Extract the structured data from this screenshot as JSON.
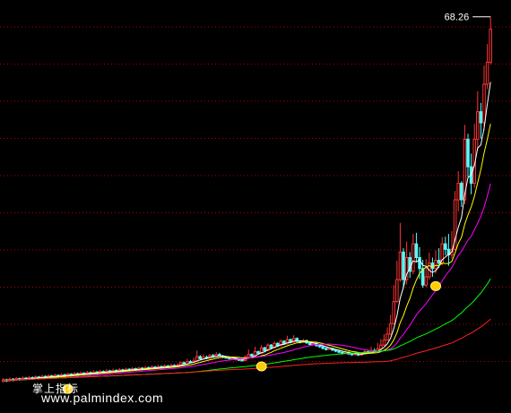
{
  "chart_data": {
    "type": "candlestick",
    "high_label": "68.26",
    "watermark": {
      "line1": "掌上指标",
      "line2": "www.palmindex.com"
    },
    "y_range": [
      0,
      70
    ],
    "grid": true,
    "colors": {
      "up": "#ff3333",
      "down": "#54ffff",
      "ma_fast": "#ffffff",
      "ma_mid": "#ffff00",
      "ma_slow": "#ff00ff",
      "ma_long": "#00ff00",
      "ma_longest": "#ff2020",
      "signal": "#ffcc00",
      "grid": "#b00000"
    },
    "signals": [
      20,
      80,
      134
    ],
    "candles": [
      [
        2.0,
        2.3,
        2.6,
        1.8
      ],
      [
        2.3,
        2.1,
        2.5,
        1.9
      ],
      [
        2.1,
        2.4,
        2.7,
        2.0
      ],
      [
        2.4,
        2.2,
        2.6,
        2.0
      ],
      [
        2.2,
        2.5,
        2.8,
        2.1
      ],
      [
        2.5,
        2.3,
        2.7,
        2.1
      ],
      [
        2.3,
        2.6,
        2.9,
        2.2
      ],
      [
        2.6,
        2.4,
        2.8,
        2.2
      ],
      [
        2.4,
        2.7,
        3.0,
        2.3
      ],
      [
        2.7,
        2.5,
        2.9,
        2.3
      ],
      [
        2.5,
        2.8,
        3.1,
        2.4
      ],
      [
        2.8,
        2.6,
        3.0,
        2.4
      ],
      [
        2.6,
        2.9,
        3.2,
        2.5
      ],
      [
        2.9,
        2.7,
        3.1,
        2.5
      ],
      [
        2.7,
        3.0,
        3.3,
        2.6
      ],
      [
        3.0,
        2.8,
        3.2,
        2.6
      ],
      [
        2.8,
        3.1,
        3.4,
        2.7
      ],
      [
        3.1,
        2.9,
        3.3,
        2.7
      ],
      [
        2.9,
        3.2,
        3.5,
        2.8
      ],
      [
        3.2,
        3.0,
        3.4,
        2.8
      ],
      [
        3.0,
        3.3,
        3.6,
        2.9
      ],
      [
        3.3,
        3.1,
        3.5,
        2.9
      ],
      [
        3.1,
        3.4,
        3.7,
        3.0
      ],
      [
        3.4,
        3.2,
        3.6,
        3.0
      ],
      [
        3.2,
        3.5,
        3.8,
        3.1
      ],
      [
        3.5,
        3.3,
        3.7,
        3.1
      ],
      [
        3.3,
        3.6,
        3.9,
        3.2
      ],
      [
        3.6,
        3.4,
        3.8,
        3.2
      ],
      [
        3.4,
        3.7,
        4.0,
        3.3
      ],
      [
        3.7,
        3.5,
        3.9,
        3.3
      ],
      [
        3.5,
        3.8,
        4.1,
        3.4
      ],
      [
        3.8,
        3.6,
        4.0,
        3.4
      ],
      [
        3.6,
        3.9,
        4.2,
        3.5
      ],
      [
        3.9,
        3.7,
        4.1,
        3.5
      ],
      [
        3.7,
        4.0,
        4.3,
        3.6
      ],
      [
        4.0,
        3.8,
        4.2,
        3.6
      ],
      [
        3.8,
        4.1,
        4.4,
        3.7
      ],
      [
        4.1,
        3.9,
        4.3,
        3.7
      ],
      [
        3.9,
        4.2,
        4.5,
        3.8
      ],
      [
        4.2,
        4.0,
        4.4,
        3.8
      ],
      [
        4.0,
        4.3,
        4.6,
        3.9
      ],
      [
        4.3,
        4.1,
        4.5,
        3.9
      ],
      [
        4.1,
        4.4,
        4.7,
        4.0
      ],
      [
        4.4,
        4.2,
        4.6,
        4.0
      ],
      [
        4.2,
        4.5,
        4.8,
        4.1
      ],
      [
        4.5,
        4.3,
        4.7,
        4.1
      ],
      [
        4.3,
        4.6,
        4.9,
        4.2
      ],
      [
        4.6,
        4.4,
        4.8,
        4.2
      ],
      [
        4.4,
        4.7,
        5.0,
        4.3
      ],
      [
        4.7,
        4.5,
        4.9,
        4.3
      ],
      [
        4.5,
        4.8,
        5.1,
        4.4
      ],
      [
        4.8,
        4.6,
        5.0,
        4.4
      ],
      [
        4.6,
        4.9,
        5.2,
        4.5
      ],
      [
        4.9,
        4.7,
        5.1,
        4.5
      ],
      [
        4.7,
        5.0,
        5.3,
        4.6
      ],
      [
        5.0,
        5.4,
        5.6,
        4.9
      ],
      [
        5.4,
        5.2,
        5.6,
        5.0
      ],
      [
        5.2,
        5.6,
        6.1,
        5.1
      ],
      [
        5.6,
        5.5,
        5.9,
        5.3
      ],
      [
        5.5,
        5.7,
        6.3,
        5.4
      ],
      [
        5.7,
        6.5,
        7.6,
        5.6
      ],
      [
        6.5,
        6.1,
        6.8,
        5.9
      ],
      [
        6.1,
        6.4,
        6.9,
        6.0
      ],
      [
        6.4,
        6.2,
        6.7,
        6.0
      ],
      [
        6.2,
        6.7,
        7.0,
        6.1
      ],
      [
        6.7,
        6.5,
        7.0,
        6.3
      ],
      [
        6.5,
        6.9,
        7.3,
        6.4
      ],
      [
        6.9,
        6.6,
        7.2,
        6.5
      ],
      [
        6.6,
        6.4,
        6.8,
        6.2
      ],
      [
        6.4,
        6.3,
        6.6,
        6.1
      ],
      [
        6.3,
        6.1,
        6.5,
        6.0
      ],
      [
        6.1,
        6.2,
        6.4,
        5.9
      ],
      [
        6.2,
        6.0,
        6.4,
        5.8
      ],
      [
        6.0,
        5.9,
        6.2,
        5.7
      ],
      [
        5.9,
        5.8,
        6.1,
        5.6
      ],
      [
        5.8,
        6.5,
        6.7,
        5.7
      ],
      [
        6.5,
        6.9,
        7.8,
        6.4
      ],
      [
        6.9,
        6.6,
        7.1,
        6.4
      ],
      [
        6.6,
        7.4,
        8.3,
        6.5
      ],
      [
        7.4,
        7.1,
        7.6,
        6.9
      ],
      [
        7.1,
        8.1,
        8.6,
        7.0
      ],
      [
        8.1,
        7.6,
        8.3,
        7.4
      ],
      [
        7.6,
        8.6,
        8.9,
        7.5
      ],
      [
        8.6,
        8.1,
        8.8,
        7.9
      ],
      [
        8.1,
        8.9,
        9.3,
        8.0
      ],
      [
        8.9,
        8.5,
        9.1,
        8.3
      ],
      [
        8.5,
        9.3,
        9.6,
        8.4
      ],
      [
        9.3,
        8.8,
        9.5,
        8.6
      ],
      [
        8.8,
        9.6,
        10.3,
        8.7
      ],
      [
        9.6,
        9.1,
        9.8,
        8.9
      ],
      [
        9.1,
        9.8,
        10.4,
        9.0
      ],
      [
        9.8,
        9.3,
        10.0,
        9.1
      ],
      [
        9.3,
        9.1,
        9.5,
        8.9
      ],
      [
        9.1,
        9.4,
        9.7,
        9.0
      ],
      [
        9.4,
        9.0,
        9.6,
        8.8
      ],
      [
        9.0,
        8.7,
        9.2,
        8.5
      ],
      [
        8.7,
        8.9,
        9.1,
        8.6
      ],
      [
        8.9,
        8.5,
        9.0,
        8.3
      ],
      [
        8.5,
        8.3,
        8.7,
        8.1
      ],
      [
        8.3,
        8.0,
        8.5,
        7.8
      ],
      [
        8.0,
        7.8,
        8.2,
        7.6
      ],
      [
        7.8,
        8.0,
        8.2,
        7.7
      ],
      [
        8.0,
        7.7,
        8.1,
        7.5
      ],
      [
        7.7,
        7.5,
        7.9,
        7.3
      ],
      [
        7.5,
        7.3,
        7.7,
        7.1
      ],
      [
        7.3,
        7.1,
        7.5,
        6.9
      ],
      [
        7.1,
        7.3,
        7.6,
        7.0
      ],
      [
        7.3,
        7.0,
        7.4,
        6.8
      ],
      [
        7.0,
        6.9,
        7.2,
        6.7
      ],
      [
        6.9,
        7.0,
        7.2,
        6.7
      ],
      [
        7.0,
        6.8,
        7.1,
        6.6
      ],
      [
        6.8,
        7.0,
        7.3,
        6.7
      ],
      [
        7.0,
        7.4,
        7.8,
        6.9
      ],
      [
        7.4,
        7.2,
        7.6,
        7.0
      ],
      [
        7.2,
        7.6,
        8.3,
        7.1
      ],
      [
        7.6,
        7.5,
        8.0,
        7.3
      ],
      [
        7.5,
        7.9,
        9.0,
        7.4
      ],
      [
        7.9,
        8.6,
        9.7,
        7.8
      ],
      [
        8.6,
        9.5,
        10.6,
        8.5
      ],
      [
        9.5,
        10.6,
        11.8,
        9.4
      ],
      [
        10.6,
        12.5,
        14.1,
        10.4
      ],
      [
        12.5,
        16.5,
        19.5,
        12.3
      ],
      [
        16.5,
        20.5,
        23.9,
        16.3
      ],
      [
        20.5,
        25.5,
        30.8,
        20.1
      ],
      [
        25.5,
        20.5,
        26.2,
        18.9
      ],
      [
        20.5,
        24.5,
        27.4,
        19.6
      ],
      [
        24.5,
        22.0,
        25.5,
        20.8
      ],
      [
        22.0,
        27.0,
        28.8,
        21.5
      ],
      [
        27.0,
        24.5,
        29.0,
        23.6
      ],
      [
        24.5,
        22.5,
        26.4,
        20.6
      ],
      [
        22.5,
        19.5,
        24.1,
        19.0
      ],
      [
        19.5,
        21.0,
        24.2,
        19.1
      ],
      [
        21.0,
        23.5,
        25.4,
        20.5
      ],
      [
        23.5,
        22.5,
        24.5,
        21.0
      ],
      [
        22.5,
        24.0,
        25.8,
        21.6
      ],
      [
        24.0,
        23.5,
        26.2,
        22.6
      ],
      [
        23.5,
        27.0,
        28.2,
        23.1
      ],
      [
        27.0,
        26.0,
        28.3,
        24.9
      ],
      [
        26.0,
        25.0,
        28.8,
        23.0
      ],
      [
        25.0,
        26.0,
        29.3,
        24.3
      ],
      [
        26.0,
        35.0,
        36.6,
        25.8
      ],
      [
        35.0,
        38.0,
        40.2,
        32.9
      ],
      [
        38.0,
        35.0,
        38.4,
        33.7
      ],
      [
        35.0,
        46.0,
        48.6,
        34.2
      ],
      [
        46.0,
        41.0,
        47.0,
        39.1
      ],
      [
        41.0,
        38.0,
        43.4,
        36.0
      ],
      [
        38.0,
        46.0,
        48.8,
        37.2
      ],
      [
        46.0,
        51.0,
        54.7,
        44.0
      ],
      [
        51.0,
        49.0,
        52.6,
        46.1
      ],
      [
        49.0,
        56.0,
        59.4,
        47.6
      ],
      [
        56.0,
        60.0,
        63.3,
        55.1
      ],
      [
        60.0,
        66.0,
        68.26,
        59.6
      ]
    ]
  }
}
